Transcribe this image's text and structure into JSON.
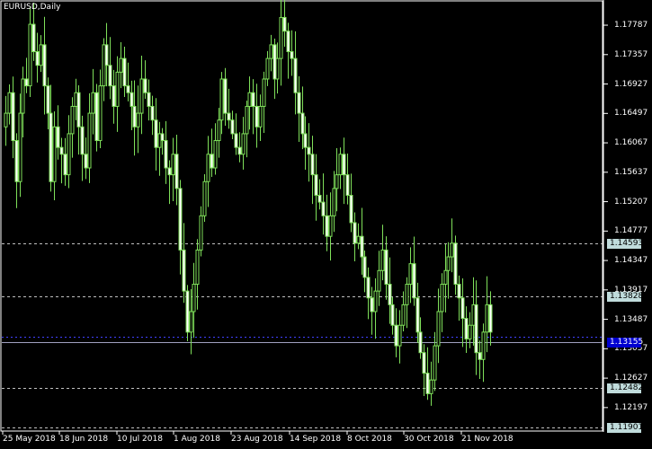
{
  "title": "EURUSD,Daily",
  "chart_data": {
    "type": "candlestick",
    "symbol": "EURUSD",
    "timeframe": "Daily",
    "ylim": [
      1.1188,
      1.1805
    ],
    "y_ticks": [
      "1.17787",
      "1.17357",
      "1.16927",
      "1.16497",
      "1.16067",
      "1.15637",
      "1.15207",
      "1.14777",
      "1.14347",
      "1.13917",
      "1.13487",
      "1.13057",
      "1.12627",
      "1.12197"
    ],
    "x_ticks": [
      "25 May 2018",
      "18 Jun 2018",
      "10 Jul 2018",
      "1 Aug 2018",
      "23 Aug 2018",
      "14 Sep 2018",
      "8 Oct 2018",
      "30 Oct 2018",
      "21 Nov 2018"
    ],
    "levels": [
      {
        "value": 1.14593,
        "label": "1.14593",
        "style": "dashed"
      },
      {
        "value": 1.13828,
        "label": "1.13828",
        "style": "dashed"
      },
      {
        "value": 1.12482,
        "label": "1.12482",
        "style": "dashed"
      },
      {
        "value": 1.11901,
        "label": "1.11901",
        "style": "dashed"
      }
    ],
    "bid": {
      "value": 1.13155,
      "label": "1.13155"
    },
    "closes": [
      1.165,
      1.168,
      1.161,
      1.155,
      1.165,
      1.17,
      1.169,
      1.178,
      1.174,
      1.172,
      1.175,
      1.169,
      1.165,
      1.155,
      1.163,
      1.16,
      1.159,
      1.156,
      1.162,
      1.166,
      1.168,
      1.163,
      1.159,
      1.157,
      1.165,
      1.168,
      1.161,
      1.169,
      1.175,
      1.172,
      1.169,
      1.166,
      1.171,
      1.173,
      1.169,
      1.168,
      1.166,
      1.163,
      1.165,
      1.17,
      1.168,
      1.166,
      1.164,
      1.16,
      1.162,
      1.161,
      1.157,
      1.156,
      1.159,
      1.154,
      1.145,
      1.139,
      1.133,
      1.136,
      1.14,
      1.145,
      1.15,
      1.155,
      1.159,
      1.157,
      1.161,
      1.164,
      1.17,
      1.165,
      1.164,
      1.162,
      1.16,
      1.159,
      1.162,
      1.166,
      1.168,
      1.166,
      1.163,
      1.166,
      1.17,
      1.173,
      1.175,
      1.17,
      1.173,
      1.179,
      1.177,
      1.174,
      1.173,
      1.168,
      1.165,
      1.162,
      1.16,
      1.159,
      1.156,
      1.153,
      1.152,
      1.15,
      1.147,
      1.15,
      1.154,
      1.156,
      1.159,
      1.156,
      1.153,
      1.149,
      1.146,
      1.147,
      1.144,
      1.141,
      1.138,
      1.136,
      1.139,
      1.142,
      1.145,
      1.14,
      1.137,
      1.134,
      1.131,
      1.134,
      1.137,
      1.14,
      1.143,
      1.138,
      1.133,
      1.13,
      1.127,
      1.124,
      1.126,
      1.131,
      1.136,
      1.14,
      1.142,
      1.144,
      1.146,
      1.14,
      1.138,
      1.135,
      1.132,
      1.134,
      1.137,
      1.13,
      1.129,
      1.133,
      1.137,
      1.133
    ]
  }
}
